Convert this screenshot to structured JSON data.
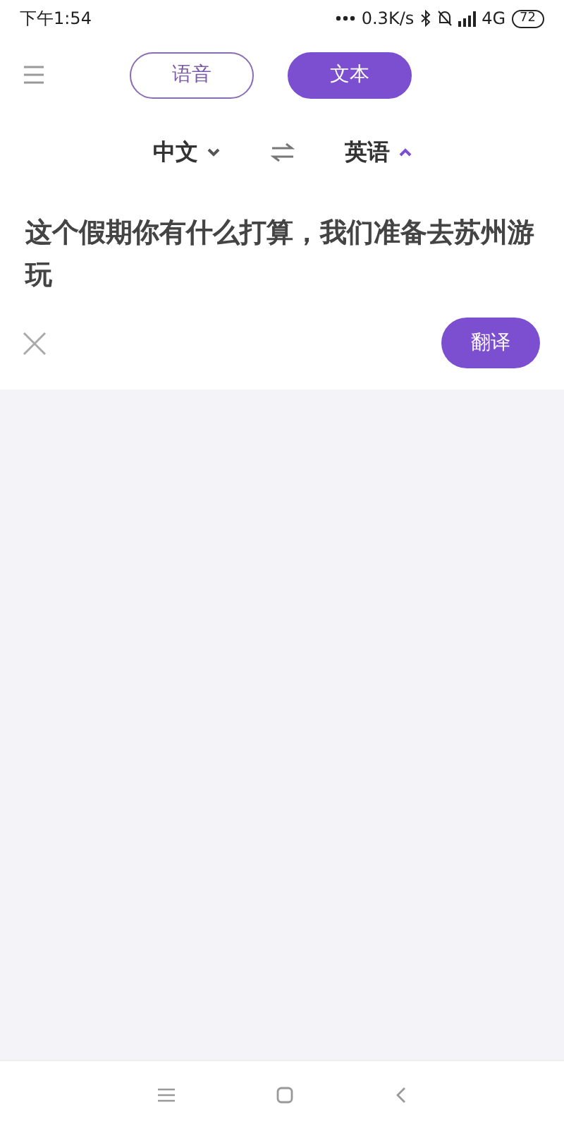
{
  "status_bar": {
    "time": "下午1:54",
    "net_speed": "0.3K/s",
    "network": "4G",
    "battery": "72"
  },
  "mode_tabs": [
    {
      "label": "语音",
      "selected": false
    },
    {
      "label": "文本",
      "selected": true
    }
  ],
  "languages": {
    "source": {
      "label": "中文",
      "expanded": false
    },
    "target": {
      "label": "英语",
      "expanded": true
    }
  },
  "input": {
    "value": "这个假期你有什么打算，我们准备去苏州游玩"
  },
  "translate_button": "翻译"
}
